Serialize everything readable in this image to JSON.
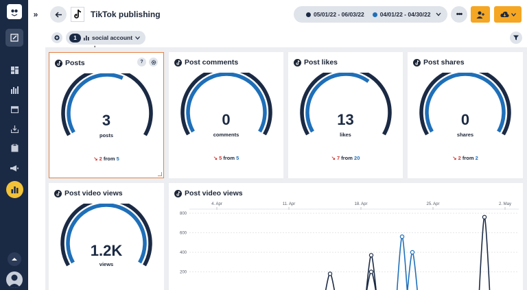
{
  "header": {
    "title": "TikTok publishing",
    "date_range_primary": "05/01/22 - 06/03/22",
    "date_range_compare": "04/01/22 - 04/30/22",
    "more_label": "•••"
  },
  "filters": {
    "account_count": "1",
    "account_label": "social account"
  },
  "colors": {
    "sidebar": "#1b2a44",
    "accent_orange": "#f5a623",
    "gauge_primary": "#1f6fb8",
    "gauge_dark": "#1b2a44",
    "gauge_track": "#c5c9d0",
    "decrease_red": "#d0312d",
    "selected_border": "#e87d3e"
  },
  "sidebar": {
    "icons": [
      "owl-logo-icon",
      "compose-icon",
      "dashboard-icon",
      "streams-icon",
      "calendar-icon",
      "inbox-icon",
      "clipboard-icon",
      "megaphone-icon",
      "analytics-icon",
      "chevron-up-icon",
      "user-avatar-icon"
    ]
  },
  "cards": [
    {
      "title": "Posts",
      "value": "3",
      "unit": "posts",
      "change": "2",
      "from_word": "from",
      "previous": "5",
      "fill_fraction": 0.6,
      "compare_fraction": 1.0
    },
    {
      "title": "Post comments",
      "value": "0",
      "unit": "comments",
      "change": "5",
      "from_word": "from",
      "previous": "5",
      "fill_fraction": 0.0,
      "compare_fraction": 1.0
    },
    {
      "title": "Post likes",
      "value": "13",
      "unit": "likes",
      "change": "7",
      "from_word": "from",
      "previous": "20",
      "fill_fraction": 0.65,
      "compare_fraction": 1.0
    },
    {
      "title": "Post shares",
      "value": "0",
      "unit": "shares",
      "change": "2",
      "from_word": "from",
      "previous": "2",
      "fill_fraction": 0.0,
      "compare_fraction": 1.0
    }
  ],
  "video_views_card": {
    "title": "Post video views",
    "value": "1.2K",
    "unit": "views",
    "fill_fraction": 1.0,
    "compare_fraction": 1.0
  },
  "video_chart_card": {
    "title": "Post video views"
  },
  "chart_data": {
    "type": "line",
    "title": "Post video views",
    "x_ticks": [
      "4. Apr",
      "11. Apr",
      "18. Apr",
      "25. Apr",
      "2. May"
    ],
    "y_ticks": [
      "800",
      "600",
      "400",
      "200"
    ],
    "ylim": [
      0,
      800
    ],
    "grid": true,
    "series": [
      {
        "color": "#1b2a44",
        "points": [
          {
            "x": "15. Apr",
            "y": 180
          },
          {
            "x": "19. Apr",
            "y": 370
          },
          {
            "x": "19. Apr",
            "y": 200
          },
          {
            "x": "30. Apr",
            "y": 760
          }
        ]
      },
      {
        "color": "#1f6fb8",
        "points": [
          {
            "x": "22. Apr",
            "y": 560
          },
          {
            "x": "23. Apr",
            "y": 400
          }
        ]
      }
    ]
  }
}
